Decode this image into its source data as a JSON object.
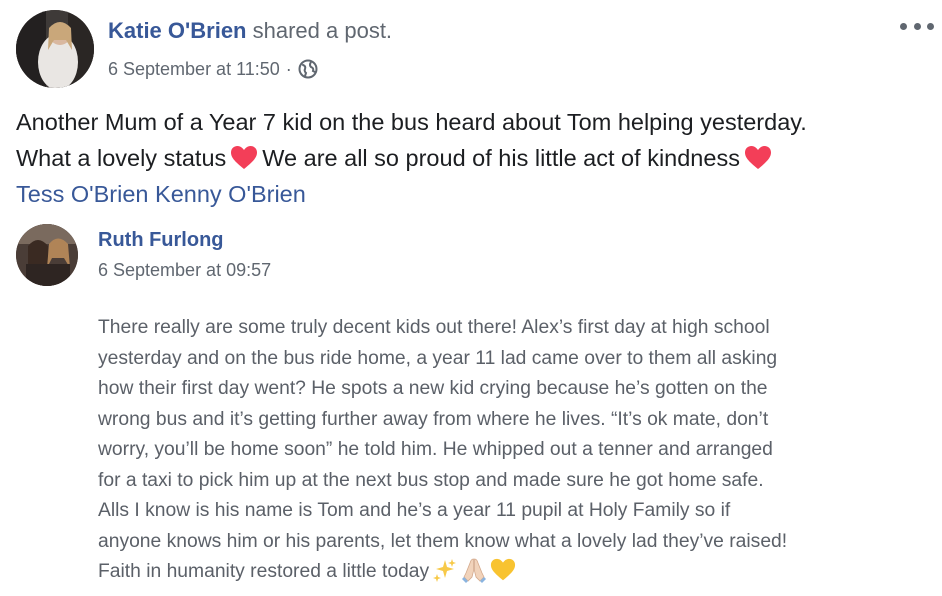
{
  "post": {
    "author": "Katie O'Brien",
    "action": "shared a post.",
    "timestamp": "6 September at 11:50",
    "separator": "·",
    "privacy_icon": "globe-icon",
    "menu_icon": "more-options-icon",
    "text_lines": [
      "Another Mum of a Year 7 kid on the bus heard about Tom helping yesterday.",
      "What a lovely status",
      "We are all so proud of his little act of kindness"
    ],
    "heart_icon": "red-heart-icon",
    "tags": [
      "Tess O'Brien",
      "Kenny O'Brien"
    ]
  },
  "shared": {
    "author": "Ruth Furlong",
    "timestamp": "6 September at 09:57",
    "text_lines": [
      "There really are some truly decent kids out there! Alex’s first day at high school",
      "yesterday and on the bus ride home, a year 11 lad came over to them all asking",
      "how their first day went? He spots a new kid crying because he’s gotten on the",
      "wrong bus and it’s getting further away from where he lives. “It’s ok mate, don’t",
      "worry, you’ll be home soon” he told him. He whipped out a tenner and arranged",
      "for a taxi to pick him up at the next bus stop and made sure he got home safe.",
      "Alls I know is his name is Tom and he’s a year 11 pupil at Holy Family so if",
      "anyone knows him or his parents, let them know what a lovely lad they’ve raised!",
      "Faith in humanity restored a little today"
    ],
    "emojis": [
      "sparkles-icon",
      "praying-hands-icon",
      "yellow-heart-icon"
    ]
  },
  "colors": {
    "link": "#385898",
    "meta": "#606770",
    "heart": "#f33e58",
    "shared_text": "#5b6068"
  }
}
